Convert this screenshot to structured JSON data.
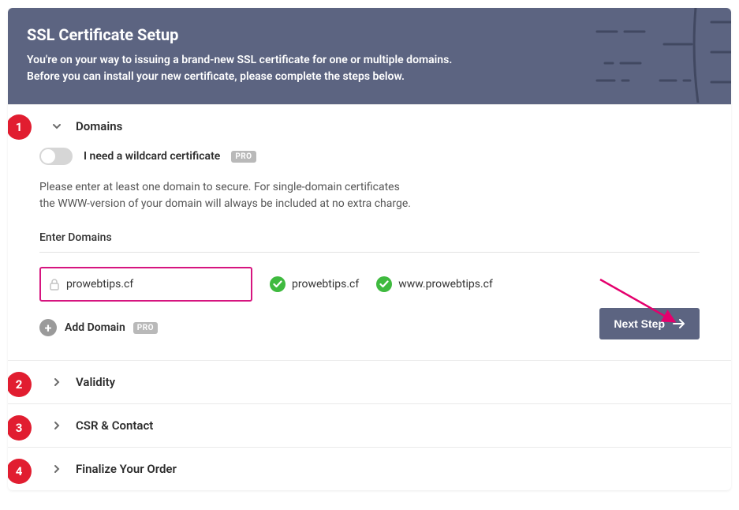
{
  "header": {
    "title": "SSL Certificate Setup",
    "subtitle_line1": "You're on your way to issuing a brand-new SSL certificate for one or multiple domains.",
    "subtitle_line2": "Before you can install your new certificate, please complete the steps below."
  },
  "steps": {
    "s1": {
      "num": "1",
      "title": "Domains"
    },
    "s2": {
      "num": "2",
      "title": "Validity"
    },
    "s3": {
      "num": "3",
      "title": "CSR & Contact"
    },
    "s4": {
      "num": "4",
      "title": "Finalize Your Order"
    }
  },
  "domains_panel": {
    "wildcard_label": "I need a wildcard certificate",
    "pro_tag": "PRO",
    "hint_line1": "Please enter at least one domain to secure. For single-domain certificates",
    "hint_line2": "the WWW-version of your domain will always be included at no extra charge.",
    "enter_label": "Enter Domains",
    "domain_value": "prowebtips.cf",
    "verified_1": "prowebtips.cf",
    "verified_2": "www.prowebtips.cf",
    "add_label": "Add Domain",
    "next_label": "Next Step"
  },
  "colors": {
    "accent_header": "#5c6481",
    "badge_red": "#e11d30",
    "input_border": "#d6157f",
    "check_green": "#3fba3f",
    "arrow": "#e4006d"
  }
}
